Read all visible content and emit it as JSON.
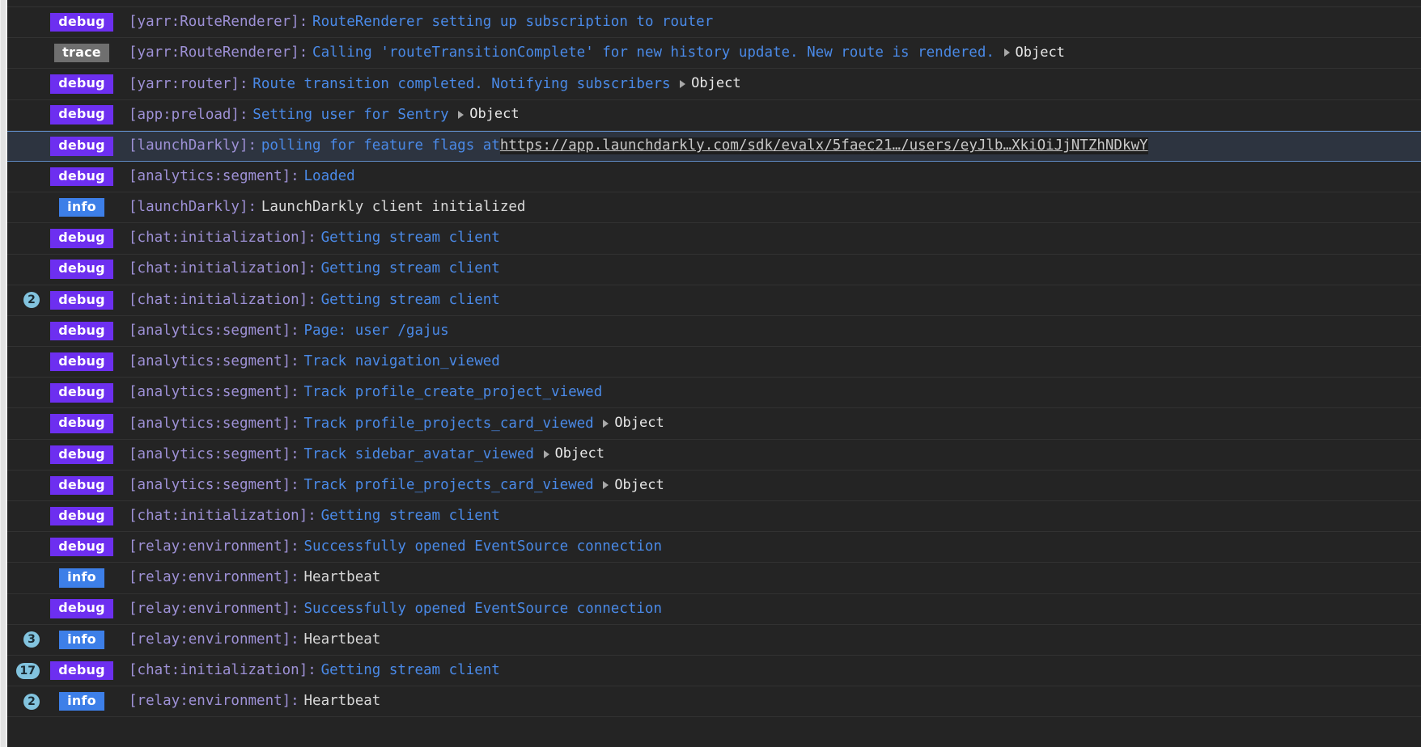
{
  "app": {
    "title": "Browser DevTools Console",
    "colors": {
      "background": "#242424",
      "row_border": "#323232",
      "debug_badge": "#6d2ff0",
      "trace_badge": "#6f6f6f",
      "info_badge": "#3d7fe8",
      "count_badge": "#82c3de",
      "namespace_text": "#9e91d6",
      "message_blue": "#4a8ae8",
      "message_white": "#d8d8d8",
      "highlight_row_bg": "#2d3440",
      "highlight_row_border": "#5f8ac4"
    }
  },
  "labels": {
    "object_expand": "Object",
    "expand_triangle_icon": "triangle-right-icon"
  },
  "rows": [
    {
      "count": "",
      "level": "debug",
      "namespace": "[yarr:RouteRenderer]:",
      "message": "RouteRenderer setting up subscription to router",
      "message_style": "blue",
      "has_object": false,
      "highlighted": false
    },
    {
      "count": "",
      "level": "trace",
      "namespace": "[yarr:RouteRenderer]:",
      "message": "Calling 'routeTransitionComplete' for new history update. New route is rendered.",
      "message_style": "blue",
      "has_object": true,
      "highlighted": false
    },
    {
      "count": "",
      "level": "debug",
      "namespace": "[yarr:router]:",
      "message": "Route transition completed. Notifying subscribers",
      "message_style": "blue",
      "has_object": true,
      "highlighted": false
    },
    {
      "count": "",
      "level": "debug",
      "namespace": "[app:preload]:",
      "message": "Setting user for Sentry",
      "message_style": "blue",
      "has_object": true,
      "highlighted": false
    },
    {
      "count": "",
      "level": "debug",
      "namespace": "[launchDarkly]:",
      "message": "polling for feature flags at",
      "message_style": "blue",
      "url": "https://app.launchdarkly.com/sdk/evalx/5faec21…/users/eyJlb…XkiOiJjNTZhNDkwY",
      "has_object": false,
      "highlighted": true
    },
    {
      "count": "",
      "level": "debug",
      "namespace": "[analytics:segment]:",
      "message": "Loaded",
      "message_style": "blue",
      "has_object": false,
      "highlighted": false
    },
    {
      "count": "",
      "level": "info",
      "namespace": "[launchDarkly]:",
      "message": "LaunchDarkly client initialized",
      "message_style": "white",
      "has_object": false,
      "highlighted": false
    },
    {
      "count": "",
      "level": "debug",
      "namespace": "[chat:initialization]:",
      "message": "Getting stream client",
      "message_style": "blue",
      "has_object": false,
      "highlighted": false
    },
    {
      "count": "",
      "level": "debug",
      "namespace": "[chat:initialization]:",
      "message": "Getting stream client",
      "message_style": "blue",
      "has_object": false,
      "highlighted": false
    },
    {
      "count": "2",
      "level": "debug",
      "namespace": "[chat:initialization]:",
      "message": "Getting stream client",
      "message_style": "blue",
      "has_object": false,
      "highlighted": false
    },
    {
      "count": "",
      "level": "debug",
      "namespace": "[analytics:segment]:",
      "message": "Page: user /gajus",
      "message_style": "blue",
      "has_object": false,
      "highlighted": false
    },
    {
      "count": "",
      "level": "debug",
      "namespace": "[analytics:segment]:",
      "message": "Track navigation_viewed",
      "message_style": "blue",
      "has_object": false,
      "highlighted": false
    },
    {
      "count": "",
      "level": "debug",
      "namespace": "[analytics:segment]:",
      "message": "Track profile_create_project_viewed",
      "message_style": "blue",
      "has_object": false,
      "highlighted": false
    },
    {
      "count": "",
      "level": "debug",
      "namespace": "[analytics:segment]:",
      "message": "Track profile_projects_card_viewed",
      "message_style": "blue",
      "has_object": true,
      "highlighted": false
    },
    {
      "count": "",
      "level": "debug",
      "namespace": "[analytics:segment]:",
      "message": "Track sidebar_avatar_viewed",
      "message_style": "blue",
      "has_object": true,
      "highlighted": false
    },
    {
      "count": "",
      "level": "debug",
      "namespace": "[analytics:segment]:",
      "message": "Track profile_projects_card_viewed",
      "message_style": "blue",
      "has_object": true,
      "highlighted": false
    },
    {
      "count": "",
      "level": "debug",
      "namespace": "[chat:initialization]:",
      "message": "Getting stream client",
      "message_style": "blue",
      "has_object": false,
      "highlighted": false
    },
    {
      "count": "",
      "level": "debug",
      "namespace": "[relay:environment]:",
      "message": "Successfully opened EventSource connection",
      "message_style": "blue",
      "has_object": false,
      "highlighted": false
    },
    {
      "count": "",
      "level": "info",
      "namespace": "[relay:environment]:",
      "message": "Heartbeat",
      "message_style": "white",
      "has_object": false,
      "highlighted": false
    },
    {
      "count": "",
      "level": "debug",
      "namespace": "[relay:environment]:",
      "message": "Successfully opened EventSource connection",
      "message_style": "blue",
      "has_object": false,
      "highlighted": false
    },
    {
      "count": "3",
      "level": "info",
      "namespace": "[relay:environment]:",
      "message": "Heartbeat",
      "message_style": "white",
      "has_object": false,
      "highlighted": false
    },
    {
      "count": "17",
      "level": "debug",
      "namespace": "[chat:initialization]:",
      "message": "Getting stream client",
      "message_style": "blue",
      "has_object": false,
      "highlighted": false
    },
    {
      "count": "2",
      "level": "info",
      "namespace": "[relay:environment]:",
      "message": "Heartbeat",
      "message_style": "white",
      "has_object": false,
      "highlighted": false
    }
  ]
}
